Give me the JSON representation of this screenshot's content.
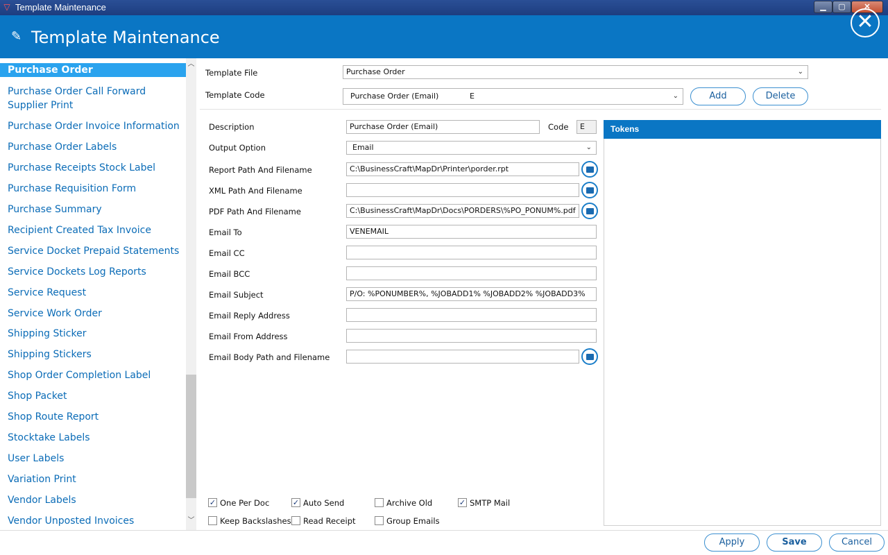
{
  "window": {
    "title": "Template Maintenance",
    "minimize": "▁",
    "maximize": "▢",
    "close": "✕"
  },
  "header": {
    "title": "Template Maintenance",
    "close": "✕"
  },
  "sidebar": {
    "items": [
      "Purchase Order",
      "Purchase Order Call Forward Supplier Print",
      "Purchase Order Invoice Information",
      "Purchase Order Labels",
      "Purchase Receipts Stock Label",
      "Purchase Requisition Form",
      "Purchase Summary",
      "Recipient Created Tax Invoice",
      "Service Docket Prepaid Statements",
      "Service Dockets Log Reports",
      "Service Request",
      "Service Work Order",
      "Shipping Sticker",
      "Shipping Stickers",
      "Shop Order Completion Label",
      "Shop Packet",
      "Shop Route Report",
      "Stocktake Labels",
      "User Labels",
      "Variation Print",
      "Vendor Labels",
      "Vendor Unposted Invoices"
    ],
    "selected": "Purchase Order"
  },
  "top": {
    "template_file_label": "Template File",
    "template_file_value": "Purchase Order",
    "template_code_label": "Template Code",
    "template_code_value": "Purchase Order (Email)",
    "template_code_code": "E",
    "add": "Add",
    "delete": "Delete"
  },
  "form": {
    "description_label": "Description",
    "description_value": "Purchase Order (Email)",
    "code_label": "Code",
    "code_value": "E",
    "output_option_label": "Output Option",
    "output_option_value": "Email",
    "report_path_label": "Report Path And Filename",
    "report_path_value": "C:\\BusinessCraft\\MapDr\\Printer\\porder.rpt",
    "xml_path_label": "XML Path And Filename",
    "xml_path_value": "",
    "pdf_path_label": "PDF Path And Filename",
    "pdf_path_value": "C:\\BusinessCraft\\MapDr\\Docs\\PORDERS\\%PO_PONUM%.pdf",
    "email_to_label": "Email To",
    "email_to_value": "VENEMAIL",
    "email_cc_label": "Email CC",
    "email_cc_value": "",
    "email_bcc_label": "Email BCC",
    "email_bcc_value": "",
    "email_subject_label": "Email Subject",
    "email_subject_value": "P/O: %PONUMBER%, %JOBADD1% %JOBADD2% %JOBADD3%",
    "email_reply_label": "Email Reply Address",
    "email_reply_value": "",
    "email_from_label": "Email From Address",
    "email_from_value": "",
    "email_body_label": "Email Body Path and Filename",
    "email_body_value": ""
  },
  "tokens": {
    "title": "Tokens"
  },
  "checkboxes": {
    "one_per_doc": {
      "label": "One Per Doc",
      "checked": true
    },
    "auto_send": {
      "label": "Auto Send",
      "checked": true
    },
    "archive_old": {
      "label": "Archive Old",
      "checked": false
    },
    "smtp_mail": {
      "label": "SMTP Mail",
      "checked": true
    },
    "keep_backslashes": {
      "label": "Keep Backslashes",
      "checked": false
    },
    "read_receipt": {
      "label": "Read Receipt",
      "checked": false
    },
    "group_emails": {
      "label": "Group Emails",
      "checked": false
    }
  },
  "footer": {
    "apply": "Apply",
    "save": "Save",
    "cancel": "Cancel"
  },
  "glyphs": {
    "chevron_down": "⌄",
    "check": "✓",
    "scroll_up": "︿",
    "scroll_down": "﹀",
    "edit_icon": "✎",
    "app_icon": "▽"
  },
  "colors": {
    "header_blue": "#0a76c4",
    "selected_item": "#2aa3ee",
    "link_blue": "#0b6cb7"
  }
}
